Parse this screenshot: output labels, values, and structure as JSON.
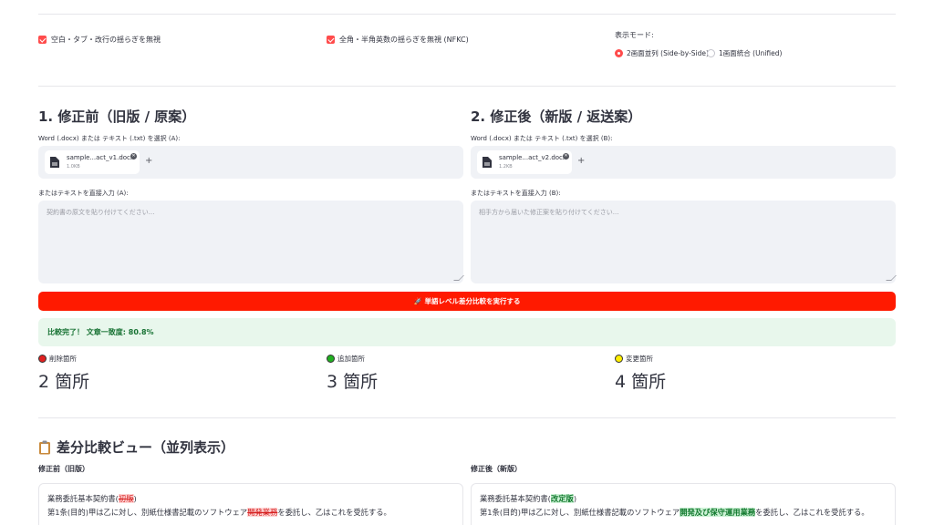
{
  "options": {
    "ignore_whitespace": "空白・タブ・改行の揺らぎを無視",
    "ignore_width": "全角・半角英数の揺らぎを無視 (NFKC)",
    "mode_label": "表示モード:",
    "mode_side": "2画面並列 (Side-by-Side)",
    "mode_unified": "1画面統合 (Unified)"
  },
  "before": {
    "title": "1. 修正前（旧版 / 原案）",
    "file_label": "Word (.docx) または テキスト (.txt) を選択 (A):",
    "file_name": "sample...act_v1.docx",
    "file_size": "1.0KB",
    "text_label": "またはテキストを直接入力 (A):",
    "placeholder": "契約書の原文を貼り付けてください..."
  },
  "after": {
    "title": "2. 修正後（新版 / 返送案）",
    "file_label": "Word (.docx) または テキスト (.txt) を選択 (B):",
    "file_name": "sample...act_v2.docx",
    "file_size": "1.2KB",
    "text_label": "またはテキストを直接入力 (B):",
    "placeholder": "相手方から届いた修正案を貼り付けてください..."
  },
  "run_button": "🚀 単語レベル差分比較を実行する",
  "success_text": "比較完了！ 文章一致度: 80.8%",
  "metrics": {
    "deleted_label": "削除箇所",
    "deleted_value": "2 箇所",
    "added_label": "追加箇所",
    "added_value": "3 箇所",
    "changed_label": "変更箇所",
    "changed_value": "4 箇所"
  },
  "colors": {
    "deleted": "#e02020",
    "added": "#21b021",
    "changed": "#ffee00",
    "accent": "#ff4b4b"
  },
  "view": {
    "title": "差分比較ビュー（並列表示）",
    "left_head": "修正前（旧版）",
    "right_head": "修正後（新版）",
    "left": {
      "l1_pre": "業務委託基本契約書(",
      "l1_del": "初版",
      "l1_post": ")",
      "l2_pre": "第1条(目的)甲は乙に対し、別紙仕様書記載のソフトウェア",
      "l2_del": "開発業務",
      "l2_post": "を委託し、乙はこれを受託する。"
    },
    "right": {
      "l1_pre": "業務委託基本契約書(",
      "l1_ins": "改定版",
      "l1_post": ")",
      "l2_pre": "第1条(目的)甲は乙に対し、別紙仕様書記載のソフトウェア",
      "l2_ins": "開発及び保守運用業務",
      "l2_post": "を委託し、乙はこれを受託する。"
    }
  }
}
